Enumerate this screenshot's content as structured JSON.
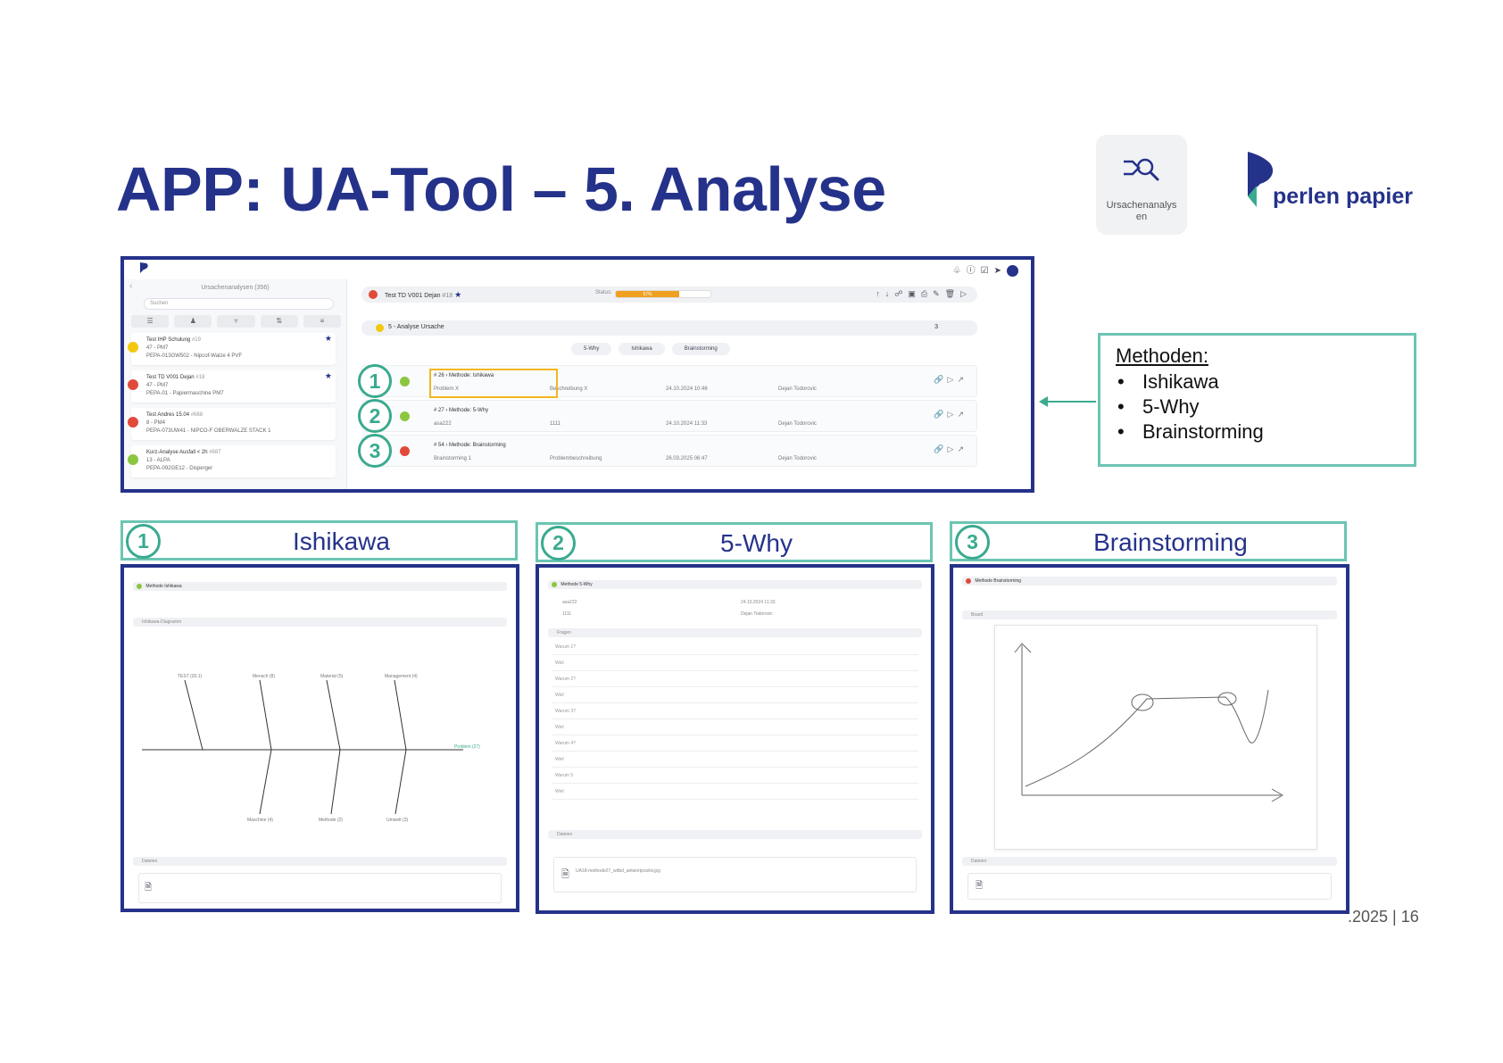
{
  "slide": {
    "title": "APP: UA-Tool – 5. Analyse",
    "footer": ".2025 | 16"
  },
  "app_icon": {
    "label": "Ursachenanalys en",
    "icon": "search-route-icon"
  },
  "logo": {
    "text": "perlen papier",
    "brand_color": "#25328a",
    "accent_color": "#3aaa8f"
  },
  "app": {
    "list_title": "Ursachenanalysen (356)",
    "search_placeholder": "Suchen",
    "list_items": [
      {
        "title": "Test IHP Schulung",
        "id": "#19",
        "line2": "47 - PM7",
        "line3": "PEPA-013GW502 - Nipcof-Walze 4 PVF",
        "status": "#f2c80f",
        "starred": true
      },
      {
        "title": "Test TD V001 Dejan",
        "id": "#18",
        "line2": "47 - PM7",
        "line3": "PEPA-01 - Papiermaschine PM7",
        "status": "#e04a3b",
        "starred": true
      },
      {
        "title": "Test Andres 15.04",
        "id": "#688",
        "line2": "8 - PM4",
        "line3": "PEPA-073UW41 - NIPCO-F OBERWALZE STACK 1",
        "status": "#e04a3b",
        "starred": false
      },
      {
        "title": "Kurz-Analyse Ausfall < 2h",
        "id": "#687",
        "line2": "13 - ALPA",
        "line3": "PEPA-092GE12 - Disperger",
        "status": "#8cc63f",
        "starred": false
      }
    ],
    "case": {
      "title": "Test TD V001 Dejan",
      "id": "#18",
      "status_label": "Status:",
      "progress": 67,
      "progress_label": "67%"
    },
    "section": {
      "title": "5 - Analyse Ursache",
      "count": "3"
    },
    "method_tabs": [
      "5-Why",
      "Ishikawa",
      "Brainstorming"
    ],
    "methods": [
      {
        "num": "1",
        "hash": "26",
        "name": "Methode: Ishikawa",
        "problem": "Problem X",
        "desc": "Beschreibung X",
        "date": "24.10.2024 10:46",
        "user": "Dejan Todorovic",
        "status": "#8cc63f"
      },
      {
        "num": "2",
        "hash": "27",
        "name": "Methode: 5-Why",
        "problem": "asa222",
        "desc": "1111",
        "date": "24.10.2024 11:33",
        "user": "Dejan Todorovic",
        "status": "#8cc63f"
      },
      {
        "num": "3",
        "hash": "54",
        "name": "Methode: Brainstorming",
        "problem": "Brainstorming 1",
        "desc": "Problembeschreibung",
        "date": "26.03.2025 06:47",
        "user": "Dejan Todorovic",
        "status": "#e04a3b"
      }
    ]
  },
  "methoden_box": {
    "heading": "Methoden:",
    "items": [
      "Ishikawa",
      "5-Why",
      "Brainstorming"
    ]
  },
  "sections": [
    {
      "num": "1",
      "title": "Ishikawa"
    },
    {
      "num": "2",
      "title": "5-Why"
    },
    {
      "num": "3",
      "title": "Brainstorming"
    }
  ],
  "ishikawa_shot": {
    "header": "Methode Ishikawa",
    "diagram_label": "Ishikawa-Diagramm",
    "top_causes": [
      "TEST (20.1)",
      "Mensch (8)",
      "Material (5)",
      "Management (4)"
    ],
    "bottom_causes": [
      "Maschine (4)",
      "Methode (2)",
      "Umwelt (3)"
    ],
    "effect": "Problem (27)",
    "files_label": "Dateien"
  },
  "why_shot": {
    "header": "Methode 5-Why",
    "problem": "asa222",
    "desc": "1111",
    "date": "24.10.2024 11:33",
    "user": "Dejan Todorovic",
    "section": "Fragen",
    "rows": [
      "Warum 1?",
      "Weil",
      "Warum 2?",
      "Weil",
      "Warum 3?",
      "Weil",
      "Warum 4?",
      "Weil",
      "Warum 5",
      "Weil"
    ],
    "files_label": "Dateien",
    "file_name": "UA18-methode27_wdbd_antwortpositiv.jpg"
  },
  "brain_shot": {
    "header": "Methode Brainstorming",
    "section": "Board",
    "files_label": "Dateien"
  }
}
